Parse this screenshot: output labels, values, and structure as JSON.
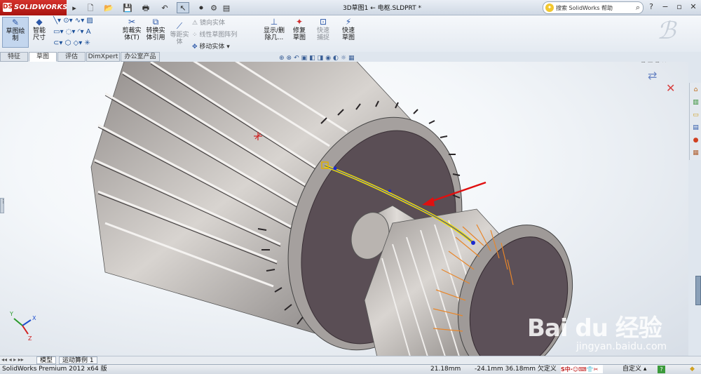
{
  "app": {
    "logo_text": "SOLIDWORKS",
    "logo_mark": "DS"
  },
  "document_title": "3D草图1 ← 电枢.SLDPRT *",
  "search": {
    "placeholder": "搜索 SolidWorks 帮助"
  },
  "command_manager": {
    "sketch": "草图绘制",
    "smart_dimension": "智能尺寸",
    "trim": "剪裁实体(T)",
    "convert": "转换实体引用",
    "offset": "等距实体",
    "mirror": "镜向实体",
    "linear_pattern": "线性草图阵列",
    "move": "移动实体",
    "display_delete": "显示/删除几...",
    "repair": "修复草图",
    "quick_snap": "快速捕捉",
    "rapid_sketch": "快速草图"
  },
  "tabs": [
    {
      "label": "特征",
      "active": false
    },
    {
      "label": "草图",
      "active": true
    },
    {
      "label": "评估",
      "active": false
    },
    {
      "label": "DimXpert",
      "active": false
    },
    {
      "label": "办公室产品",
      "active": false
    }
  ],
  "model_tabs": [
    "模型",
    "运动算例 1"
  ],
  "status": {
    "product": "SolidWorks Premium 2012 x64 版",
    "length": "21.18mm",
    "coords": "-24.1mm 36.18mm 欠定义",
    "custom": "自定义"
  },
  "watermark": {
    "brand": "Bai du 经验",
    "url": "jingyan.baidu.com"
  },
  "colors": {
    "accent": "#2b57a8",
    "logo_red": "#c21c17",
    "arrow_red": "#e01010",
    "sketch_yellow": "#f0e000"
  }
}
